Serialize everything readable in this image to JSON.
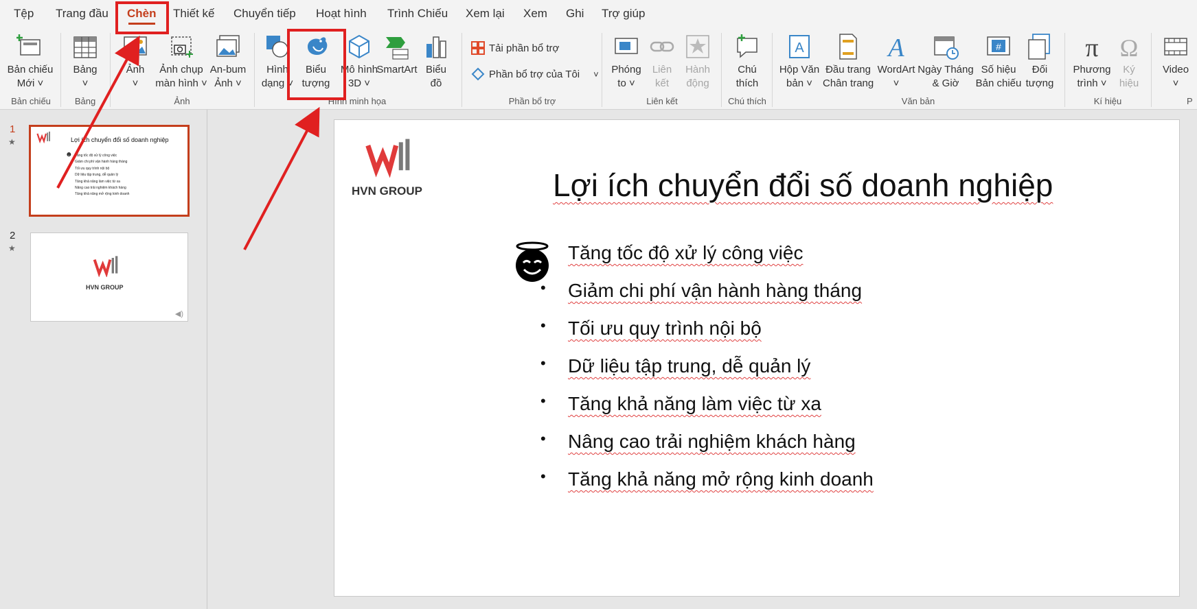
{
  "menu": {
    "tabs": [
      "Tệp",
      "Trang đầu",
      "Chèn",
      "Thiết kế",
      "Chuyển tiếp",
      "Hoạt hình",
      "Trình Chiếu",
      "Xem lại",
      "Xem",
      "Ghi",
      "Trợ giúp"
    ],
    "active": "Chèn"
  },
  "ribbon": {
    "new_slide": [
      "Bản chiếu",
      "Mới ˅"
    ],
    "table": [
      "Bảng",
      "˅"
    ],
    "image": [
      "Ảnh",
      "˅"
    ],
    "screenshot": [
      "Ảnh chụp",
      "màn hình ˅"
    ],
    "album": [
      "An-bum",
      "Ảnh ˅"
    ],
    "shapes": [
      "Hình",
      "dạng ˅"
    ],
    "icons": [
      "Biểu",
      "tượng"
    ],
    "model3d": [
      "Mô hình",
      "3D ˅"
    ],
    "smartart": [
      "SmartArt"
    ],
    "chart": [
      "Biểu",
      "đồ"
    ],
    "get_addins": "Tải phần bổ trợ",
    "my_addins": "Phần bổ trợ của Tôi",
    "zoom": [
      "Phóng",
      "to ˅"
    ],
    "link": [
      "Liên",
      "kết"
    ],
    "action": [
      "Hành",
      "động"
    ],
    "comment": [
      "Chú",
      "thích"
    ],
    "textbox": [
      "Hộp Văn",
      "bản ˅"
    ],
    "header_footer": [
      "Đầu trang",
      "Chân trang"
    ],
    "wordart": [
      "WordArt",
      "˅"
    ],
    "datetime": [
      "Ngày Tháng",
      "& Giờ"
    ],
    "slide_number": [
      "Số hiệu",
      "Bản chiếu"
    ],
    "object": [
      "Đối",
      "tượng"
    ],
    "equation": [
      "Phương",
      "trình ˅"
    ],
    "symbol": [
      "Ký",
      "hiệu"
    ],
    "video": [
      "Video",
      "˅"
    ],
    "groups": {
      "slides": "Bản chiếu",
      "tables": "Bảng",
      "images": "Ảnh",
      "illustrations": "Hình minh họa",
      "addins": "Phần bổ trợ",
      "links": "Liên kết",
      "comments": "Chú thích",
      "text": "Văn bản",
      "symbols": "Kí hiệu",
      "media": "P"
    }
  },
  "thumbnails": [
    {
      "num": "1",
      "title": "Lợi ích chuyển đổi số doanh nghiệp",
      "items": [
        "Tăng tốc độ xử lý công việc",
        "Giảm chi phí vận hành hàng tháng",
        "Tối ưu quy trình nội bộ",
        "Dữ liệu tập trung, dễ quản lý",
        "Tăng khả năng làm việc từ xa",
        "Nâng cao trải nghiệm khách hàng",
        "Tăng khả năng mở rộng kinh doanh"
      ],
      "logo": "HVN GROUP"
    },
    {
      "num": "2",
      "logo": "HVN GROUP"
    }
  ],
  "slide": {
    "logo_text": "HVN GROUP",
    "title": "Lợi ích chuyển đổi số doanh nghiệp",
    "bullets": [
      "Tăng tốc độ xử lý công việc",
      "Giảm chi phí vận hành hàng tháng",
      "Tối ưu quy trình nội bộ",
      "Dữ liệu tập trung, dễ quản lý",
      "Tăng khả năng làm việc từ xa",
      "Nâng cao trải nghiệm khách hàng",
      "Tăng khả năng mở rộng kinh doanh"
    ],
    "bullet_char": "•"
  },
  "colors": {
    "accent": "#c43e1c",
    "annotation": "#e02020",
    "logo_red": "#e03a3a",
    "logo_gray": "#7a7a7a"
  }
}
